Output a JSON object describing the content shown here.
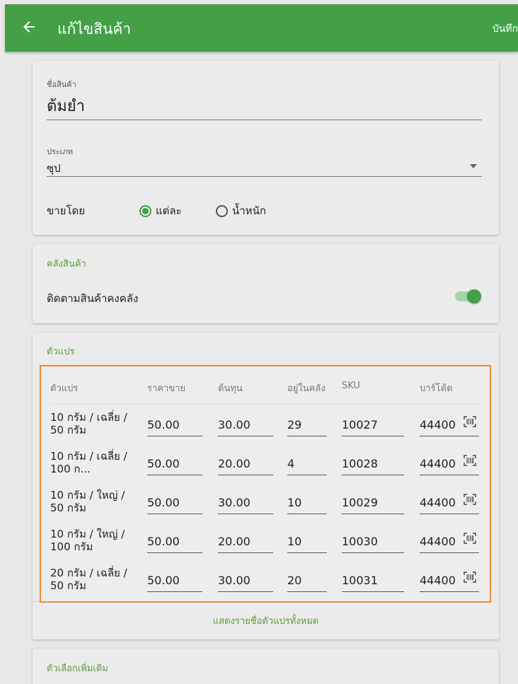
{
  "appbar": {
    "title": "แก้ไขสินค้า",
    "save_label": "บันทึก",
    "back_icon": "arrow-left-icon",
    "color": "#43a047"
  },
  "product": {
    "name_label": "ชื่อสินค้า",
    "name_value": "ต้มยำ",
    "category_label": "ประเภท",
    "category_value": "ซุป",
    "sell_by_label": "ขายโดย",
    "sell_by_options": [
      "แต่ละ",
      "น้ำหนัก"
    ],
    "sell_by_selected": "แต่ละ"
  },
  "inventory": {
    "section_title": "คลังสินค้า",
    "track_label": "ติดตามสินค้าคงคลัง",
    "track_enabled": true
  },
  "variants": {
    "section_title": "ตัวแปร",
    "headers": [
      "ตัวแปร",
      "ราคาขาย",
      "ต้นทุน",
      "อยู่ในคลัง",
      "SKU",
      "บาร์โค้ด"
    ],
    "rows": [
      {
        "name": "10 กรัม / เฉลี่ย / 50 กรัม",
        "price": "50.00",
        "cost": "30.00",
        "stock": "29",
        "sku": "10027",
        "barcode": "44400"
      },
      {
        "name": "10 กรัม / เฉลี่ย / 100 ก...",
        "price": "50.00",
        "cost": "20.00",
        "stock": "4",
        "sku": "10028",
        "barcode": "44400"
      },
      {
        "name": "10 กรัม / ใหญ่ / 50 กรัม",
        "price": "50.00",
        "cost": "30.00",
        "stock": "10",
        "sku": "10029",
        "barcode": "44400"
      },
      {
        "name": "10 กรัม / ใหญ่ / 100 กรัม",
        "price": "50.00",
        "cost": "20.00",
        "stock": "10",
        "sku": "10030",
        "barcode": "44400"
      },
      {
        "name": "20 กรัม / เฉลี่ย / 50 กรัม",
        "price": "50.00",
        "cost": "30.00",
        "stock": "20",
        "sku": "10031",
        "barcode": "44400"
      }
    ],
    "show_all_label": "แสดงรายชื่อตัวแปรทั้งหมด",
    "highlight_color": "#ef8a32"
  },
  "extra": {
    "section_title": "ตัวเลือกเพิ่มเติม"
  }
}
